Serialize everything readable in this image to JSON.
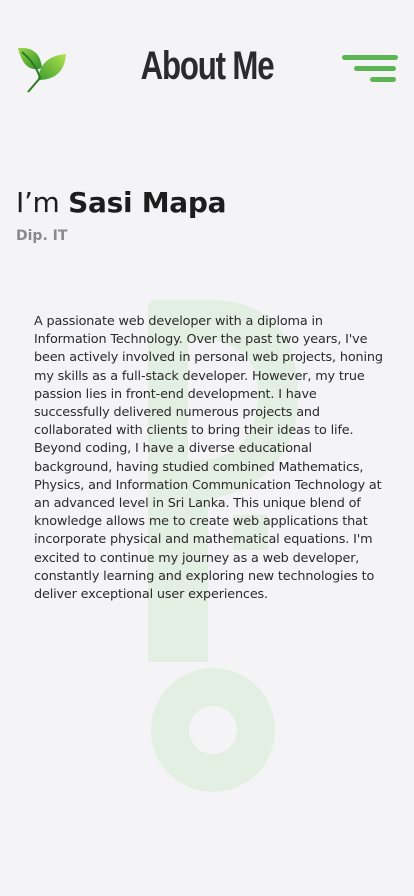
{
  "header": {
    "title": "About Me",
    "logo_icon": "leaf-icon",
    "menu_icon": "hamburger-menu-icon",
    "accent_color": "#5cb553"
  },
  "profile": {
    "greeting": "I’m",
    "name": "Sasi Mapa",
    "qualification": "Dip. IT"
  },
  "bio": {
    "text": "A passionate web developer with a diploma in Information Technology. Over the past two years, I've been actively involved in personal web projects, honing my skills as a full-stack developer. However, my true passion lies in front-end development. I have successfully delivered numerous projects and collaborated with clients to bring their ideas to life. Beyond coding, I have a diverse educational background, having studied combined Mathematics, Physics, and Information Communication Technology at an advanced level in Sri Lanka. This unique blend of knowledge allows me to create web applications that incorporate physical and mathematical equations. I'm excited to continue my journey as a web developer, constantly learning and exploring new technologies to deliver exceptional user experiences."
  },
  "background": {
    "watermark_color": "#e3efe2"
  }
}
